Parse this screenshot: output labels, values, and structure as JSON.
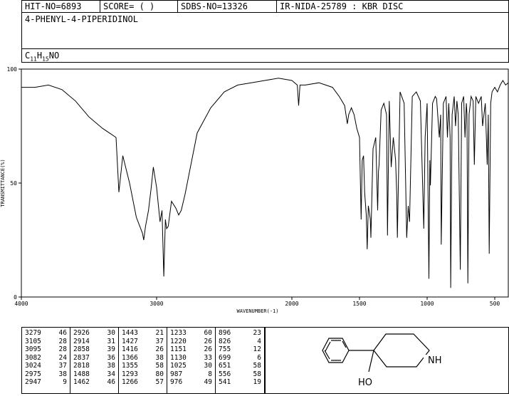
{
  "header": {
    "hit_no": "HIT-NO=6893",
    "score": "SCORE=  (    )",
    "sdbs_no": "SDBS-NO=13326",
    "ir_nida": "IR-NIDA-25789 : KBR DISC"
  },
  "compound": {
    "name": "4-PHENYL-4-PIPERIDINOL",
    "formula_parts": [
      "C",
      "11",
      "H",
      "15",
      "NO"
    ]
  },
  "chart_data": {
    "type": "line",
    "xlabel": "WAVENUMBER(-1)",
    "ylabel": "TRANSMITTANCE(%)",
    "xlim": [
      4000,
      400
    ],
    "ylim": [
      0,
      100
    ],
    "x_ticks": [
      4000,
      3000,
      2000,
      1500,
      1000,
      500
    ],
    "y_ticks": [
      0,
      50,
      100
    ],
    "grid": false,
    "series": [
      {
        "x": [
          4000,
          3900,
          3800,
          3700,
          3600,
          3500,
          3400,
          3350,
          3300,
          3279,
          3250,
          3200,
          3150,
          3105,
          3095,
          3082,
          3060,
          3040,
          3024,
          3000,
          2975,
          2960,
          2947,
          2935,
          2926,
          2914,
          2890,
          2858,
          2837,
          2818,
          2790,
          2700,
          2600,
          2500,
          2400,
          2300,
          2200,
          2100,
          2000,
          1960,
          1950,
          1940,
          1900,
          1800,
          1700,
          1650,
          1610,
          1600,
          1590,
          1580,
          1560,
          1540,
          1520,
          1500,
          1488,
          1480,
          1470,
          1462,
          1450,
          1443,
          1435,
          1427,
          1420,
          1416,
          1400,
          1380,
          1366,
          1360,
          1355,
          1340,
          1320,
          1300,
          1293,
          1280,
          1266,
          1250,
          1233,
          1225,
          1220,
          1200,
          1170,
          1151,
          1140,
          1130,
          1110,
          1080,
          1050,
          1025,
          1015,
          1000,
          987,
          980,
          976,
          960,
          940,
          930,
          910,
          900,
          896,
          880,
          860,
          850,
          840,
          830,
          826,
          815,
          800,
          790,
          780,
          770,
          755,
          745,
          730,
          720,
          710,
          705,
          699,
          690,
          675,
          660,
          651,
          640,
          620,
          600,
          590,
          570,
          556,
          548,
          541,
          530,
          520,
          500,
          480,
          460,
          440,
          420,
          400
        ],
        "y": [
          92,
          92,
          93,
          91,
          86,
          79,
          74,
          72,
          70,
          46,
          62,
          50,
          35,
          28,
          25,
          31,
          38,
          48,
          57,
          48,
          33,
          38,
          9,
          34,
          30,
          31,
          42,
          39,
          36,
          38,
          45,
          72,
          83,
          90,
          93,
          94,
          95,
          96,
          95,
          93,
          84,
          93,
          93,
          94,
          92,
          88,
          84,
          80,
          76,
          80,
          83,
          80,
          74,
          70,
          34,
          60,
          62,
          46,
          36,
          21,
          40,
          37,
          34,
          26,
          65,
          70,
          38,
          55,
          58,
          82,
          85,
          80,
          27,
          86,
          57,
          70,
          60,
          45,
          26,
          90,
          85,
          26,
          40,
          33,
          88,
          90,
          86,
          30,
          70,
          85,
          8,
          60,
          49,
          85,
          88,
          87,
          70,
          80,
          23,
          85,
          88,
          70,
          85,
          70,
          4,
          80,
          88,
          75,
          86,
          80,
          12,
          85,
          88,
          70,
          85,
          80,
          6,
          80,
          88,
          86,
          58,
          88,
          85,
          88,
          75,
          85,
          58,
          80,
          19,
          85,
          90,
          92,
          90,
          93,
          95,
          93,
          94
        ]
      }
    ]
  },
  "peak_table": [
    [
      [
        "3279",
        "46"
      ],
      [
        "3105",
        "28"
      ],
      [
        "3095",
        "28"
      ],
      [
        "3082",
        "24"
      ],
      [
        "3024",
        "37"
      ],
      [
        "2975",
        "38"
      ],
      [
        "2947",
        "9"
      ]
    ],
    [
      [
        "2926",
        "30"
      ],
      [
        "2914",
        "31"
      ],
      [
        "2858",
        "39"
      ],
      [
        "2837",
        "36"
      ],
      [
        "2818",
        "38"
      ],
      [
        "1488",
        "34"
      ],
      [
        "1462",
        "46"
      ]
    ],
    [
      [
        "1443",
        "21"
      ],
      [
        "1427",
        "37"
      ],
      [
        "1416",
        "26"
      ],
      [
        "1366",
        "38"
      ],
      [
        "1355",
        "58"
      ],
      [
        "1293",
        "80"
      ],
      [
        "1266",
        "57"
      ]
    ],
    [
      [
        "1233",
        "60"
      ],
      [
        "1220",
        "26"
      ],
      [
        "1151",
        "26"
      ],
      [
        "1130",
        "33"
      ],
      [
        "1025",
        "30"
      ],
      [
        "987",
        "8"
      ],
      [
        "976",
        "49"
      ]
    ],
    [
      [
        "896",
        "23"
      ],
      [
        "826",
        "4"
      ],
      [
        "755",
        "12"
      ],
      [
        "699",
        "6"
      ],
      [
        "651",
        "58"
      ],
      [
        "556",
        "58"
      ],
      [
        "541",
        "19"
      ]
    ]
  ],
  "structure": {
    "labels": {
      "nh": "NH",
      "ho": "HO"
    }
  }
}
